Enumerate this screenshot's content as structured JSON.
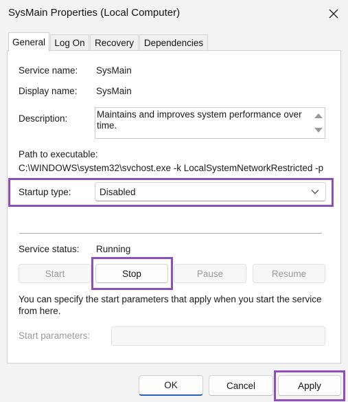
{
  "window": {
    "title": "SysMain Properties (Local Computer)"
  },
  "tabs": [
    {
      "label": "General",
      "active": true
    },
    {
      "label": "Log On",
      "active": false
    },
    {
      "label": "Recovery",
      "active": false
    },
    {
      "label": "Dependencies",
      "active": false
    }
  ],
  "general": {
    "service_name_label": "Service name:",
    "service_name_value": "SysMain",
    "display_name_label": "Display name:",
    "display_name_value": "SysMain",
    "description_label": "Description:",
    "description_value": "Maintains and improves system performance over time.",
    "path_label": "Path to executable:",
    "path_value": "C:\\WINDOWS\\system32\\svchost.exe -k LocalSystemNetworkRestricted -p",
    "startup_type_label": "Startup type:",
    "startup_type_value": "Disabled",
    "service_status_label": "Service status:",
    "service_status_value": "Running",
    "start_label": "Start",
    "stop_label": "Stop",
    "pause_label": "Pause",
    "resume_label": "Resume",
    "hint_line1": "You can specify the start parameters that apply when you start the service",
    "hint_line2": "from here.",
    "start_params_label": "Start parameters:"
  },
  "footer": {
    "ok_label": "OK",
    "cancel_label": "Cancel",
    "apply_label": "Apply"
  },
  "colors": {
    "highlight": "#8d4fc0",
    "primary_accent": "#2b5fb4"
  }
}
